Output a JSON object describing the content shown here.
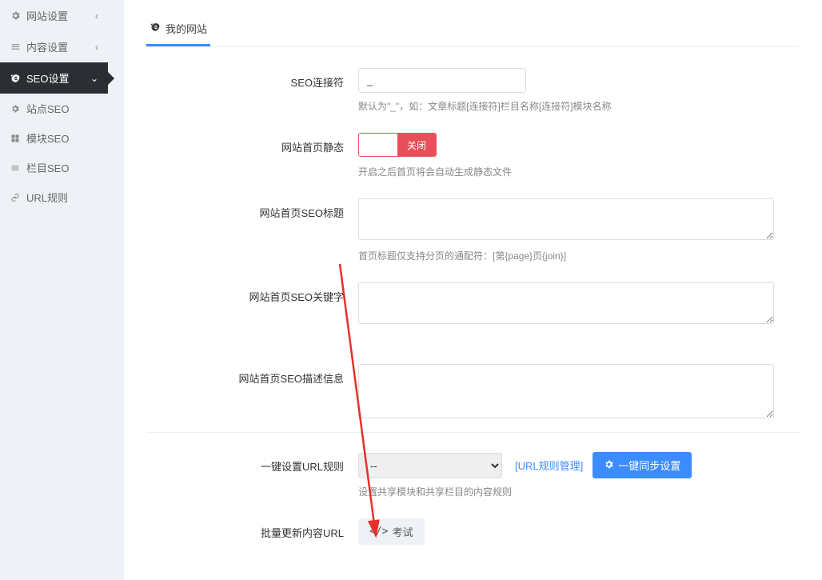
{
  "sidebar": {
    "items": [
      {
        "label": "网站设置"
      },
      {
        "label": "内容设置"
      },
      {
        "label": "SEO设置"
      }
    ],
    "subs": [
      {
        "label": "站点SEO"
      },
      {
        "label": "模块SEO"
      },
      {
        "label": "栏目SEO"
      },
      {
        "label": "URL规则"
      }
    ]
  },
  "tab": {
    "title": "我的网站"
  },
  "form": {
    "connector": {
      "label": "SEO连接符",
      "value": "_",
      "help": "默认为\"_\"，如：文章标题[连接符]栏目名称[连接符]模块名称"
    },
    "homestatic": {
      "label": "网站首页静态",
      "state": "关闭",
      "help": "开启之后首页将会自动生成静态文件"
    },
    "seotitle": {
      "label": "网站首页SEO标题",
      "help": "首页标题仅支持分页的通配符：[第{page}页{join}]"
    },
    "seokeywords": {
      "label": "网站首页SEO关键字"
    },
    "seodesc": {
      "label": "网站首页SEO描述信息"
    },
    "urlrule": {
      "label": "一键设置URL规则",
      "select_default": "--",
      "link": "[URL规则管理]",
      "button": "一键同步设置",
      "help": "设置共享模块和共享栏目的内容规则"
    },
    "batch": {
      "label": "批量更新内容URL",
      "button": "考试"
    }
  }
}
